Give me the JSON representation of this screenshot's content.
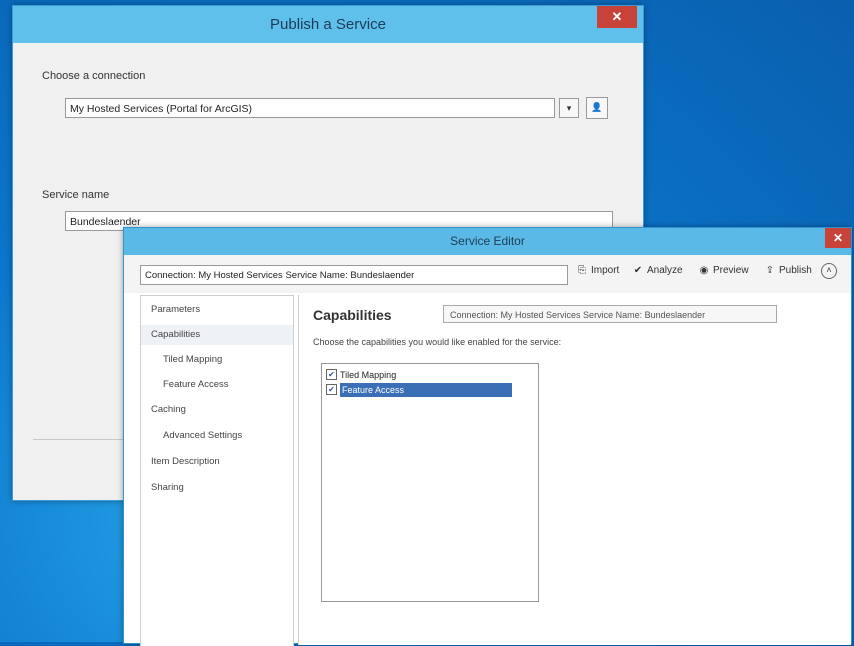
{
  "publish_dialog": {
    "title": "Publish a Service",
    "close_label": "✕",
    "connection_label": "Choose a connection",
    "connection_value": "My Hosted Services (Portal for ArcGIS)",
    "service_name_label": "Service name",
    "service_name_value": "Bundeslaender"
  },
  "service_editor": {
    "title": "Service Editor",
    "close_label": "✕",
    "header_field": "Connection: My Hosted Services  Service Name: Bundeslaender",
    "toolbar": {
      "import": "Import",
      "analyze": "Analyze",
      "preview": "Preview",
      "publish": "Publish"
    },
    "nav": {
      "parameters": "Parameters",
      "capabilities": "Capabilities",
      "tiled_mapping": "Tiled Mapping",
      "feature_access": "Feature Access",
      "caching": "Caching",
      "advanced_settings": "Advanced Settings",
      "item_description": "Item Description",
      "sharing": "Sharing"
    },
    "content": {
      "heading": "Capabilities",
      "connection_box": "Connection: My Hosted Services  Service Name: Bundeslaender",
      "description": "Choose the capabilities you would like enabled for the service:",
      "items": {
        "tiled_mapping": "Tiled Mapping",
        "feature_access": "Feature Access"
      }
    }
  },
  "icons": {
    "import": "import-icon",
    "analyze": "check-icon",
    "preview": "preview-icon",
    "publish": "publish-icon",
    "collapse": "chevron-up-icon"
  }
}
